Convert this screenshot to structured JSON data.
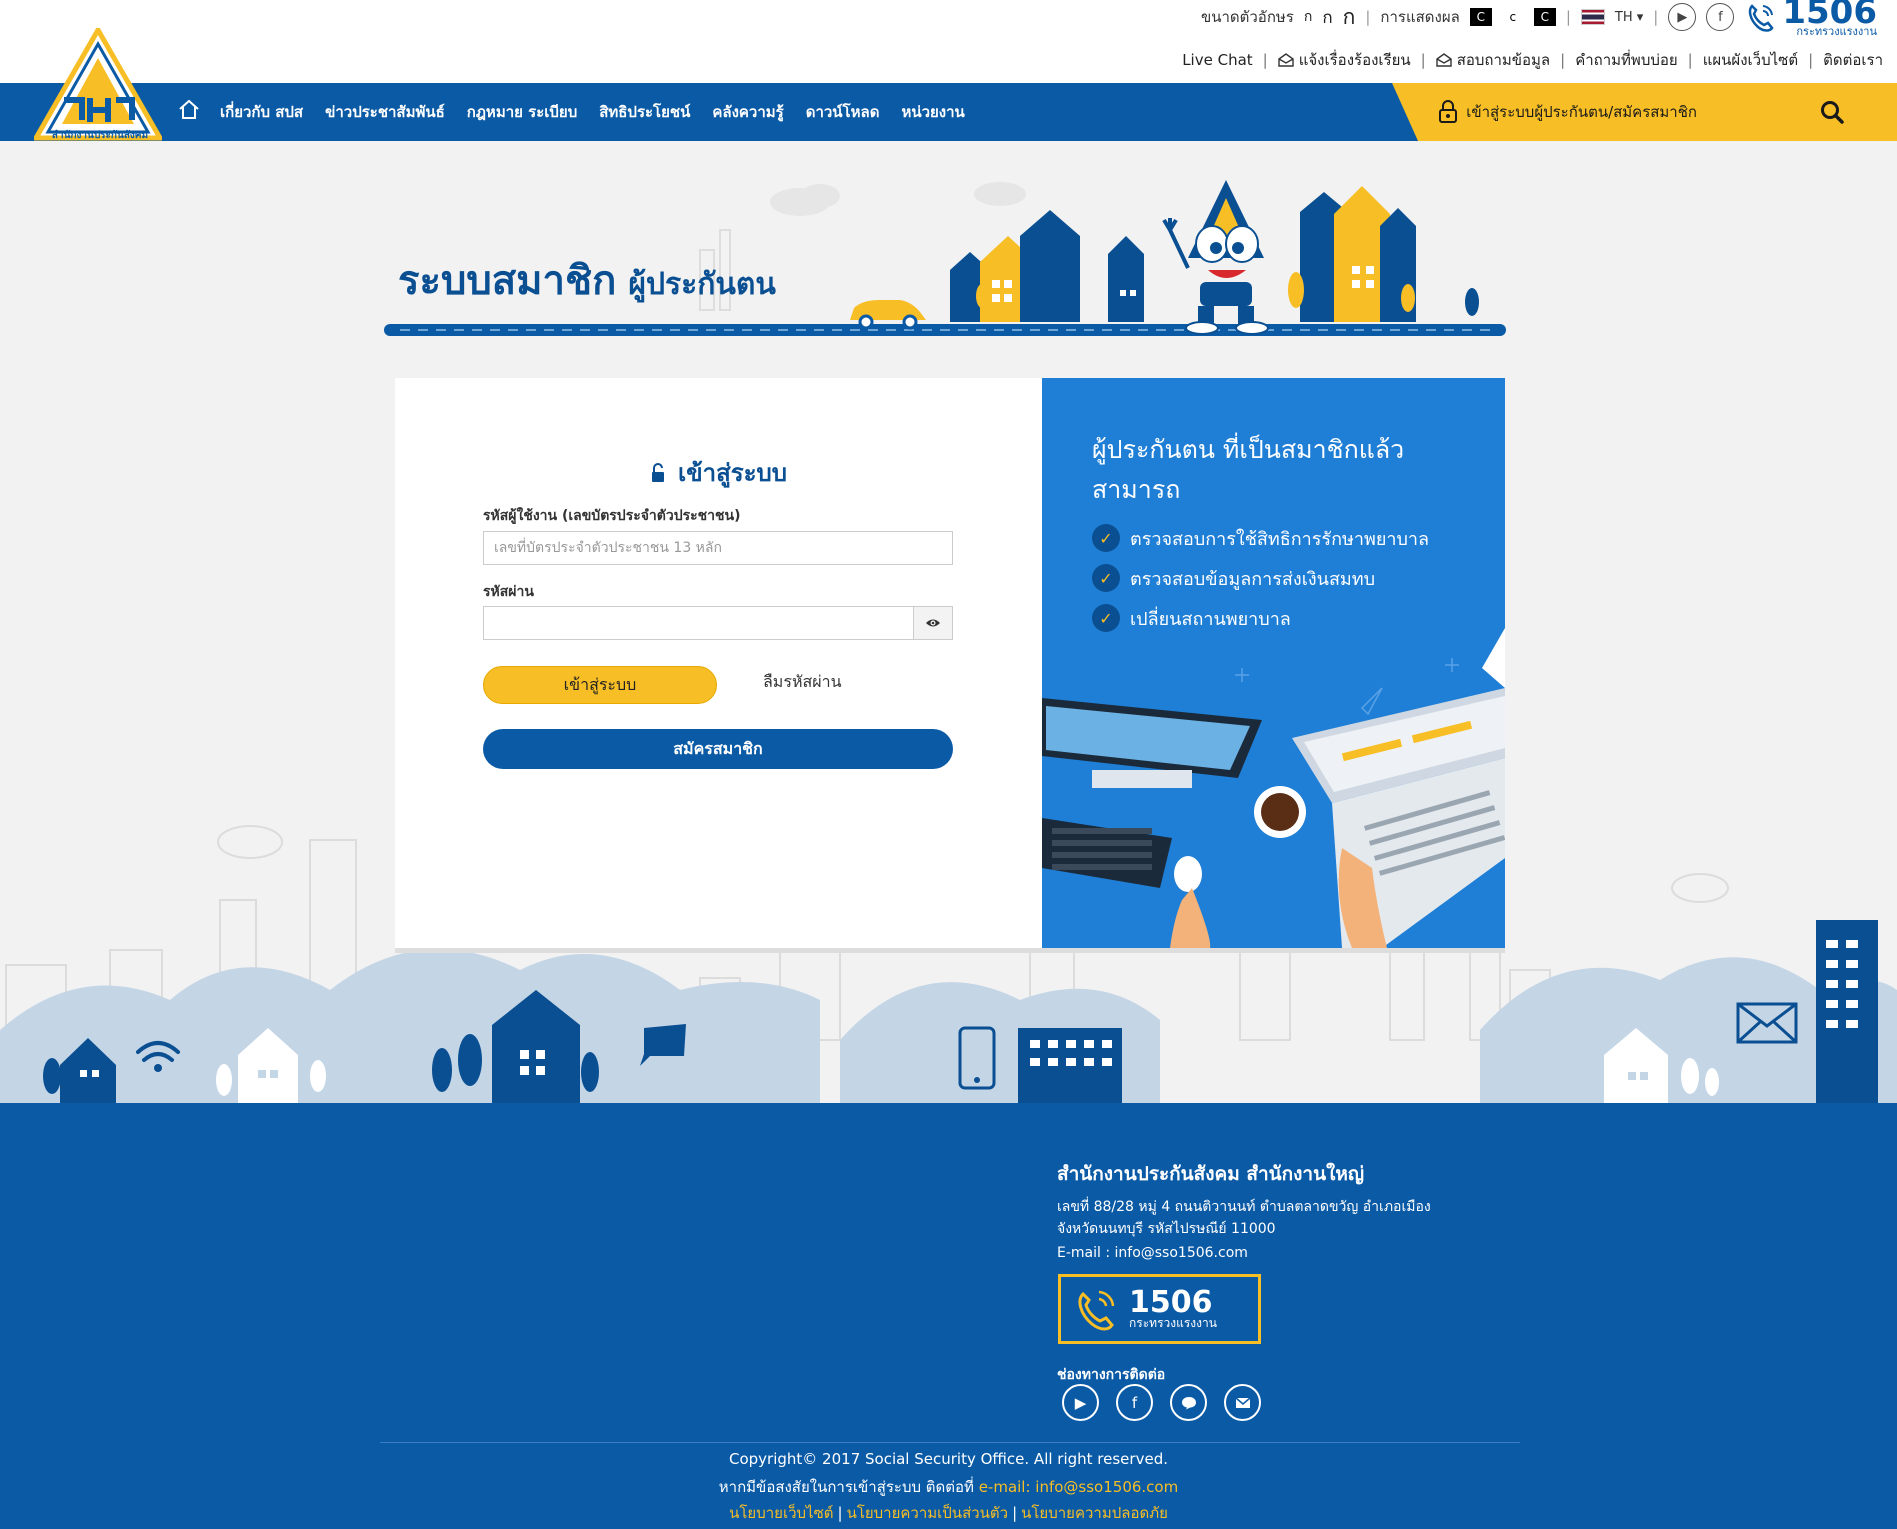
{
  "utility": {
    "font_size_label": "ขนาดตัวอักษร",
    "font_sizes": [
      "ก",
      "ก",
      "ก"
    ],
    "display_label": "การแสดงผล",
    "contrast_options": [
      "C",
      "c",
      "C"
    ],
    "language": "TH",
    "hotline_number": "1506",
    "hotline_sub": "กระทรวงแรงงาน"
  },
  "quick_links": {
    "live_chat": "Live Chat",
    "complaint": "แจ้งเรื่องร้องเรียน",
    "inquiry": "สอบถามข้อมูล",
    "faq": "คำถามที่พบบ่อย",
    "sitemap": "แผนผังเว็บไซต์",
    "contact": "ติดต่อเรา"
  },
  "logo": {
    "text": "สำนักงานประกันสังคม"
  },
  "nav": {
    "items": [
      "เกี่ยวกับ สปส",
      "ข่าวประชาสัมพันธ์",
      "กฎหมาย ระเบียบ",
      "สิทธิประโยชน์",
      "คลังความรู้",
      "ดาวน์โหลด",
      "หน่วยงาน"
    ],
    "login_link": "เข้าสู่ระบบผู้ประกันตน/สมัครสมาชิก"
  },
  "banner": {
    "title": "ระบบสมาชิก",
    "subtitle": "ผู้ประกันตน"
  },
  "login": {
    "title": "เข้าสู่ระบบ",
    "username_label": "รหัสผู้ใช้งาน (เลขบัตรประจำตัวประชาชน)",
    "username_placeholder": "เลขที่บัตรประจำตัวประชาชน 13 หลัก",
    "username_value": "",
    "password_label": "รหัสผ่าน",
    "password_value": "",
    "login_button": "เข้าสู่ระบบ",
    "forgot_link": "ลืมรหัสผ่าน",
    "register_button": "สมัครสมาชิก"
  },
  "promo": {
    "title": "ผู้ประกันตน ที่เป็นสมาชิกแล้ว สามารถ",
    "benefits": [
      "ตรวจสอบการใช้สิทธิการรักษาพยาบาล",
      "ตรวจสอบข้อมูลการส่งเงินสมทบ",
      "เปลี่ยนสถานพยาบาล"
    ]
  },
  "footer": {
    "org_title": "สำนักงานประกันสังคม สำนักงานใหญ่",
    "address_line1": "เลขที่ 88/28 หมู่ 4 ถนนติวานนท์ ตำบลตลาดขวัญ อำเภอเมือง",
    "address_line2": "จังหวัดนนทบุรี รหัสไปรษณีย์ 11000",
    "email": "E-mail : info@sso1506.com",
    "hotline_number": "1506",
    "hotline_sub": "กระทรวงแรงงาน",
    "channels_label": "ช่องทางการติดต่อ",
    "copyright": "Copyright© 2017 Social Security Office. All right reserved.",
    "contact_prefix": "หากมีข้อสงสัยในการเข้าสู่ระบบ ติดต่อที่",
    "contact_email": "e-mail: info@sso1506.com",
    "policies": [
      "นโยบายเว็บไซต์",
      "นโยบายความเป็นส่วนตัว",
      "นโยบายความปลอดภัย"
    ]
  },
  "colors": {
    "primary_blue": "#0a5aa6",
    "accent_yellow": "#f7be25",
    "promo_blue": "#1f7fd6"
  }
}
